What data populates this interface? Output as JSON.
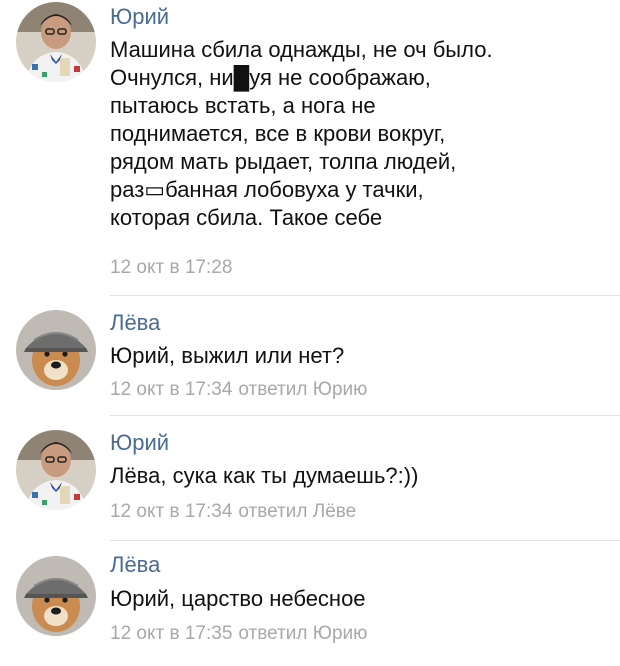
{
  "comments": [
    {
      "author": "Юрий",
      "avatar_icon": "man-portrait-avatar",
      "text": "Машина сбила однажды, не оч было.\nОчнулся, ни█уя не соображаю,\nпытаюсь встать, а нога не\nподнимается, все в крови вокруг,\nрядом мать рыдает, толпа людей,\nраз▭банная лобовуха у тачки,\nкоторая сбила. Такое себе",
      "time": "12 окт в 17:28",
      "reply_to": ""
    },
    {
      "author": "Лёва",
      "avatar_icon": "dog-in-cap-avatar",
      "text": "Юрий, выжил или нет?",
      "time": "12 окт в 17:34",
      "reply_to": "ответил Юрию"
    },
    {
      "author": "Юрий",
      "avatar_icon": "man-portrait-avatar",
      "text": "Лёва, сука как ты думаешь?:))",
      "time": "12 окт в 17:34",
      "reply_to": "ответил Лёве"
    },
    {
      "author": "Лёва",
      "avatar_icon": "dog-in-cap-avatar",
      "text": "Юрий, царство небесное",
      "time": "12 окт в 17:35",
      "reply_to": "ответил Юрию"
    }
  ],
  "colors": {
    "author": "#4a6b94",
    "text": "#111111",
    "meta": "#a8a8a8",
    "divider": "#e3e3e3"
  }
}
